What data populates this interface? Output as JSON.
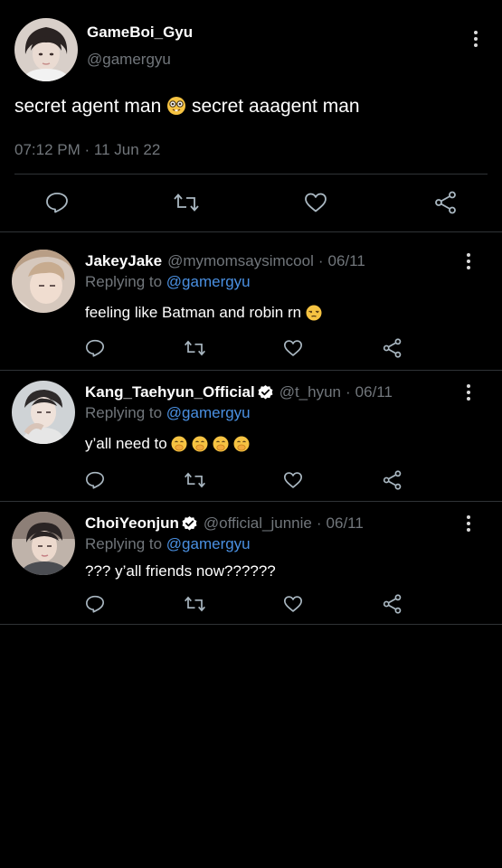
{
  "main_tweet": {
    "display_name": "GameBoi_Gyu",
    "handle": "@gamergyu",
    "text_part1": "secret agent man ",
    "text_emoji": "nerd-face",
    "text_part2": " secret aaagent man",
    "timestamp": "07:12 PM · 11 Jun 22",
    "actions": [
      "reply-icon",
      "retweet-icon",
      "like-icon",
      "share-icon"
    ]
  },
  "replies": [
    {
      "display_name": "JakeyJake",
      "verified": false,
      "handle": "@mymomsaysimcool",
      "separator": "·",
      "date": "06/11",
      "replying_prefix": "Replying to ",
      "replying_to": "@gamergyu",
      "text": "feeling like Batman and robin rn ",
      "emoji": "unamused-face"
    },
    {
      "display_name": "Kang_Taehyun_Official",
      "verified": true,
      "handle": "@t_hyun",
      "separator": "·",
      "date": "06/11",
      "replying_prefix": "Replying to ",
      "replying_to": "@gamergyu",
      "text": "y’all need to ",
      "emoji": "face-with-hand-over-mouth ×4"
    },
    {
      "display_name": "ChoiYeonjun",
      "verified": true,
      "handle": "@official_junnie",
      "separator": "·",
      "date": "06/11",
      "replying_prefix": "Replying to ",
      "replying_to": "@gamergyu",
      "text": "??? y’all friends now??????",
      "emoji": ""
    }
  ],
  "colors": {
    "background": "#000000",
    "text_primary": "#ffffff",
    "text_secondary": "#71767b",
    "link": "#4a90e2",
    "divider": "#2f3336"
  }
}
